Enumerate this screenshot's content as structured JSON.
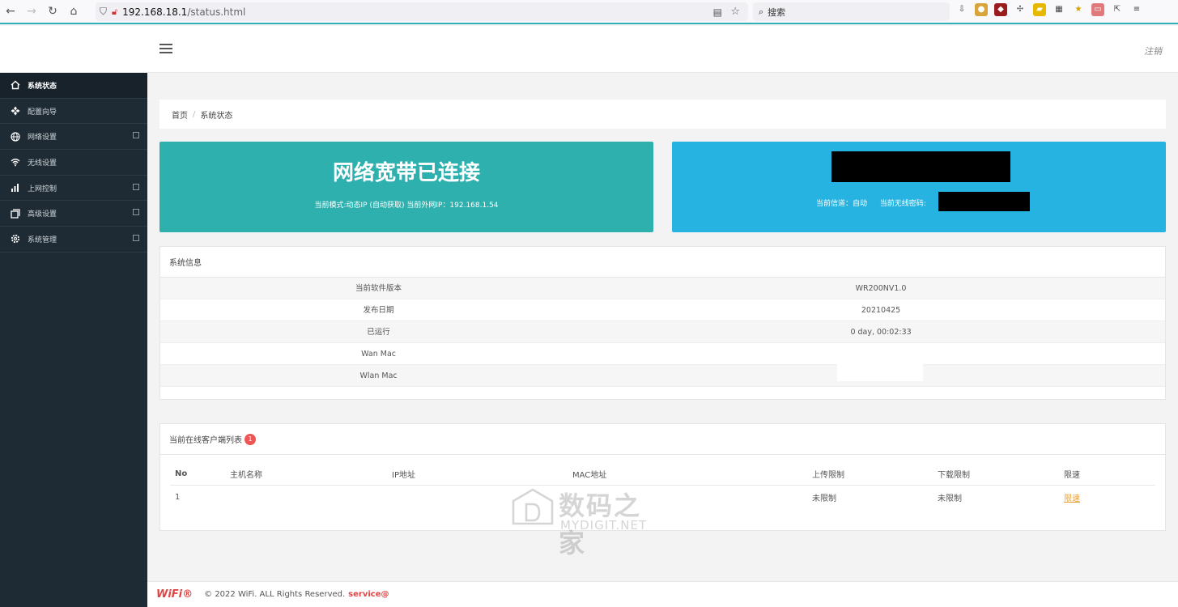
{
  "browser": {
    "url_host": "192.168.18.1",
    "url_path": "/status.html",
    "search_placeholder": "搜索"
  },
  "header": {
    "logout": "注销"
  },
  "sidebar": {
    "items": [
      {
        "label": "系统状态",
        "icon": "home-icon"
      },
      {
        "label": "配置向导",
        "icon": "wizard-icon"
      },
      {
        "label": "网络设置",
        "icon": "globe-icon"
      },
      {
        "label": "无线设置",
        "icon": "wifi-icon"
      },
      {
        "label": "上网控制",
        "icon": "bars-icon"
      },
      {
        "label": "高级设置",
        "icon": "copy-icon"
      },
      {
        "label": "系统管理",
        "icon": "gear-icon"
      }
    ]
  },
  "breadcrumb": {
    "home": "首页",
    "sep": "/",
    "current": "系统状态"
  },
  "cards": {
    "wan_title": "网络宽带已连接",
    "wan_sub": "当前模式:动态IP (自动获取)   当前外网IP：192.168.1.54",
    "wifi_sub_channel": "当前信道：自动",
    "wifi_sub_pwd": "当前无线密码:"
  },
  "sysinfo": {
    "title": "系统信息",
    "rows": [
      {
        "k": "当前软件版本",
        "v": "WR200NV1.0"
      },
      {
        "k": "发布日期",
        "v": "20210425"
      },
      {
        "k": "已运行",
        "v": "0 day, 00:02:33"
      },
      {
        "k": "Wan Mac",
        "v": ""
      },
      {
        "k": "Wlan Mac",
        "v": ""
      }
    ]
  },
  "clients": {
    "title": "当前在线客户端列表",
    "count": "1",
    "headers": [
      "No",
      "主机名称",
      "IP地址",
      "MAC地址",
      "上传限制",
      "下载限制",
      "限速"
    ],
    "rows": [
      {
        "no": "1",
        "host": "",
        "ip": "",
        "mac": "",
        "up": "未限制",
        "down": "未限制",
        "action": "限速"
      }
    ]
  },
  "watermark": {
    "cn": "数码之家",
    "en": "MYDIGIT.NET"
  },
  "footer": {
    "brand": "WiFi®",
    "copy": "© 2022 WiFi. ALL Rights Reserved.",
    "service": "service@"
  }
}
